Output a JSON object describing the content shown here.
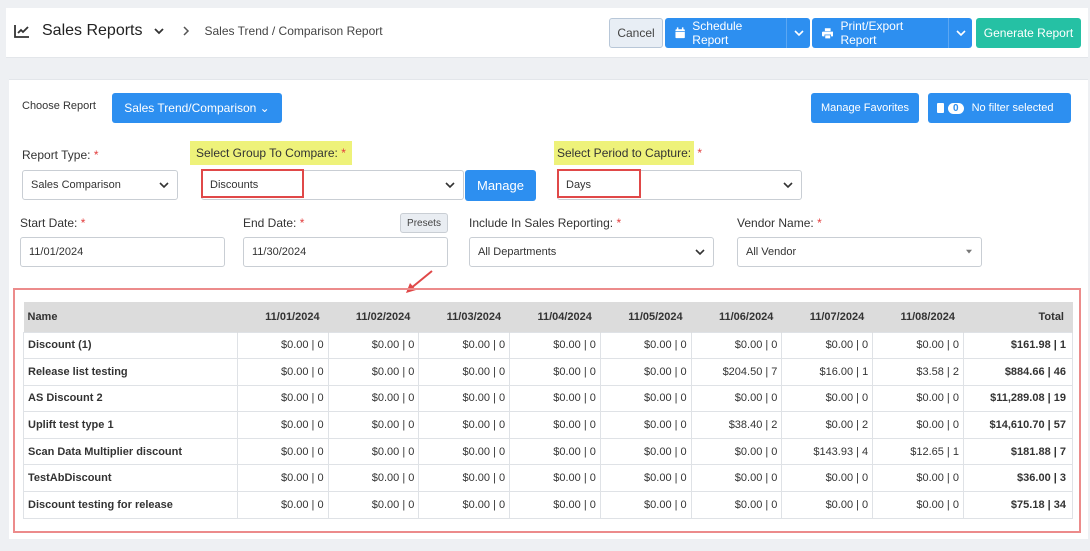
{
  "header": {
    "title": "Sales Reports",
    "breadcrumb": "Sales Trend / Comparison Report",
    "cancel": "Cancel",
    "schedule": "Schedule Report",
    "print": "Print/Export Report",
    "generate": "Generate Report"
  },
  "choose": {
    "label": "Choose Report",
    "selected": "Sales Trend/Comparison ⌄",
    "manage_favorites": "Manage Favorites",
    "filter_count": "0",
    "filter_text": "No filter selected"
  },
  "form": {
    "report_type_label": "Report Type:",
    "report_type_value": "Sales Comparison",
    "group_label": "Select Group To Compare:",
    "group_value": "Discounts",
    "manage": "Manage",
    "period_label": "Select Period to Capture:",
    "period_value": "Days",
    "start_label": "Start Date:",
    "start_value": "11/01/2024",
    "end_label": "End Date:",
    "end_value": "11/30/2024",
    "presets": "Presets",
    "include_label": "Include In Sales Reporting:",
    "include_value": "All Departments",
    "vendor_label": "Vendor Name:",
    "vendor_value": "All Vendor",
    "required_mark": "*"
  },
  "table": {
    "headers": [
      "Name",
      "11/01/2024",
      "11/02/2024",
      "11/03/2024",
      "11/04/2024",
      "11/05/2024",
      "11/06/2024",
      "11/07/2024",
      "11/08/2024",
      "Total"
    ],
    "rows": [
      [
        "Discount (1)",
        "$0.00 | 0",
        "$0.00 | 0",
        "$0.00 | 0",
        "$0.00 | 0",
        "$0.00 | 0",
        "$0.00 | 0",
        "$0.00 | 0",
        "$0.00 | 0",
        "$161.98 | 1"
      ],
      [
        "Release list testing",
        "$0.00 | 0",
        "$0.00 | 0",
        "$0.00 | 0",
        "$0.00 | 0",
        "$0.00 | 0",
        "$204.50 | 7",
        "$16.00 | 1",
        "$3.58 | 2",
        "$884.66 | 46"
      ],
      [
        "AS Discount 2",
        "$0.00 | 0",
        "$0.00 | 0",
        "$0.00 | 0",
        "$0.00 | 0",
        "$0.00 | 0",
        "$0.00 | 0",
        "$0.00 | 0",
        "$0.00 | 0",
        "$11,289.08 | 19"
      ],
      [
        "Uplift test type 1",
        "$0.00 | 0",
        "$0.00 | 0",
        "$0.00 | 0",
        "$0.00 | 0",
        "$0.00 | 0",
        "$38.40 | 2",
        "$0.00 | 2",
        "$0.00 | 0",
        "$14,610.70 | 57"
      ],
      [
        "Scan Data Multiplier discount",
        "$0.00 | 0",
        "$0.00 | 0",
        "$0.00 | 0",
        "$0.00 | 0",
        "$0.00 | 0",
        "$0.00 | 0",
        "$143.93 | 4",
        "$12.65 | 1",
        "$181.88 | 7"
      ],
      [
        "TestAbDiscount",
        "$0.00 | 0",
        "$0.00 | 0",
        "$0.00 | 0",
        "$0.00 | 0",
        "$0.00 | 0",
        "$0.00 | 0",
        "$0.00 | 0",
        "$0.00 | 0",
        "$36.00 | 3"
      ],
      [
        "Discount testing for release",
        "$0.00 | 0",
        "$0.00 | 0",
        "$0.00 | 0",
        "$0.00 | 0",
        "$0.00 | 0",
        "$0.00 | 0",
        "$0.00 | 0",
        "$0.00 | 0",
        "$75.18 | 34"
      ]
    ]
  },
  "icons": {
    "chart": "trend-chart-icon",
    "calendar": "calendar-icon",
    "printer": "printer-icon"
  },
  "colors": {
    "primary": "#2d8ff0",
    "success": "#25c1a4",
    "highlight": "#eef27a",
    "annotation": "#e04848"
  }
}
